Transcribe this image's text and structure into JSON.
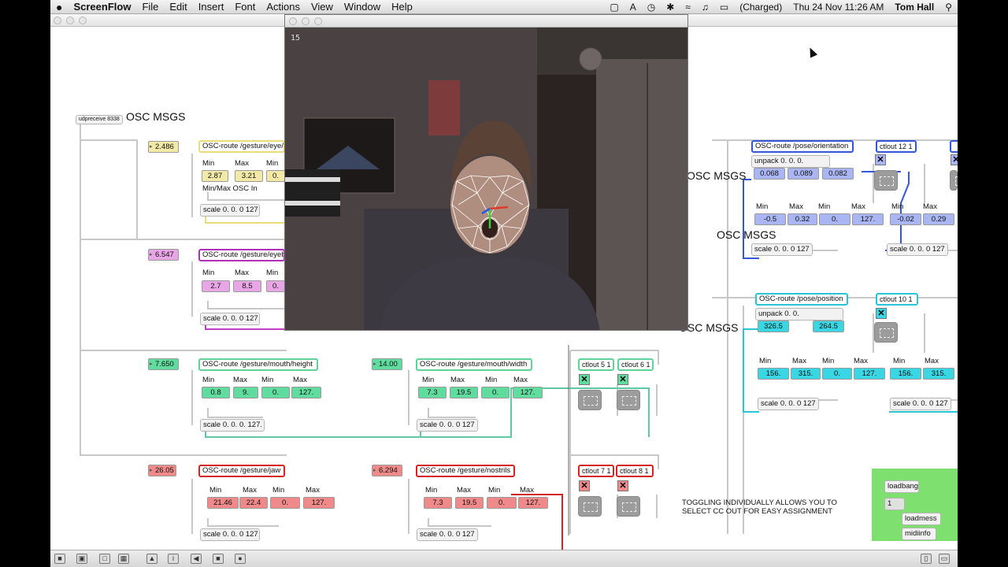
{
  "menubar": {
    "apple": "",
    "app": "ScreenFlow",
    "items": [
      "File",
      "Edit",
      "Insert",
      "Font",
      "Actions",
      "View",
      "Window",
      "Help"
    ],
    "battery": "(Charged)",
    "datetime": "Thu 24 Nov  11:26 AM",
    "user": "Tom Hall"
  },
  "video": {
    "fps": "15"
  },
  "patch": {
    "udpreceive": "udpreceive 8338",
    "osc_msgs": "OSC MSGS",
    "eye": {
      "num": "2.486",
      "route": "OSC-route /gesture/eye/le",
      "min": "2.87",
      "max": "3.21",
      "other": "0.",
      "caption": "Min/Max OSC In",
      "scale": "scale 0. 0. 0 127"
    },
    "eyebrow": {
      "num": "6.547",
      "route": "OSC-route /gesture/eyeb",
      "min": "2.7",
      "max": "8.5",
      "other": "0.",
      "scale": "scale 0. 0. 0 127"
    },
    "mouth_h": {
      "num": "7.650",
      "route": "OSC-route /gesture/mouth/height",
      "min": "0.8",
      "max": "9.",
      "min2": "0.",
      "max2": "127.",
      "scale": "scale 0. 0. 0. 127."
    },
    "mouth_w": {
      "num": "14.00",
      "route": "OSC-route /gesture/mouth/width",
      "min": "7.3",
      "max": "19.5",
      "min2": "0.",
      "max2": "127.",
      "scale": "scale 0. 0. 0 127"
    },
    "jaw": {
      "num": "26.05",
      "route": "OSC-route /gesture/jaw",
      "min": "21.46",
      "max": "22.4",
      "min2": "0.",
      "max2": "127.",
      "scale": "scale 0. 0. 0 127"
    },
    "nostrils": {
      "num": "6.294",
      "route": "OSC-route /gesture/nostrils",
      "min": "7.3",
      "max": "19.5",
      "min2": "0.",
      "max2": "127.",
      "scale": "scale 0. 0. 0 127"
    },
    "ctlout5": "ctlout 5 1",
    "ctlout6": "ctlout 6 1",
    "ctlout7": "ctlout 7 1",
    "ctlout8": "ctlout 8 1",
    "orientation": {
      "route": "OSC-route /pose/orientation",
      "unpack": "unpack 0. 0. 0.",
      "v1": "0.068",
      "v2": "0.089",
      "v3": "0.082",
      "min": "-0.5",
      "max": "0.32",
      "min2": "0.",
      "max2": "127.",
      "minb": "-0.02",
      "maxb": "0.29",
      "scale1": "scale 0. 0. 0 127",
      "scale2": "scale 0. 0. 0 127"
    },
    "ctlout12": "ctlout 12 1",
    "position": {
      "route": "OSC-route /pose/position",
      "unpack": "unpack 0. 0.",
      "v1": "326.5",
      "v2": "264.5",
      "min": "156.",
      "max": "315.",
      "min2": "0.",
      "max2": "127.",
      "minb": "156.",
      "maxb": "315.",
      "scale1": "scale 0. 0. 0 127",
      "scale2": "scale 0. 0. 0 127"
    },
    "ctlout10": "ctlout 10 1",
    "labels": {
      "min": "Min",
      "max": "Max"
    },
    "note": "TOGGLING INDIVIDUALLY ALLOWS YOU TO SELECT CC OUT FOR EASY ASSIGNMENT",
    "loadbang": "loadbang",
    "one": "1",
    "loadmess": "loadmess",
    "midiinfo": "midiinfo"
  },
  "colors": {
    "yellow": "#f1e9a5",
    "pink": "#e9a6e6",
    "green": "#5fdc9e",
    "red": "#f08a8a",
    "blue": "#a9b6f3",
    "cyan": "#39d7e3",
    "blue_route": "#3456d9",
    "cyan_route": "#2ac4d6",
    "red_route": "#d42424",
    "green_route": "#5fd49a",
    "purple_route": "#b02fb8"
  }
}
